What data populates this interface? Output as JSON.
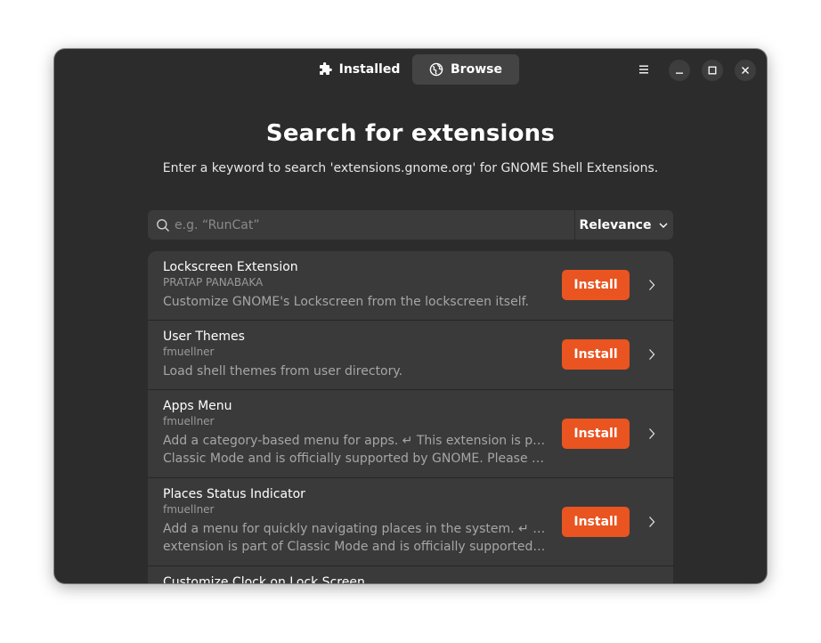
{
  "header": {
    "tabs": [
      {
        "label": "Installed",
        "icon": "puzzle-icon"
      },
      {
        "label": "Browse",
        "icon": "globe-icon"
      }
    ],
    "active_tab": "Browse",
    "buttons": [
      "menu-icon",
      "minimize-icon",
      "maximize-icon",
      "close-icon"
    ]
  },
  "main": {
    "title": "Search for extensions",
    "subtitle": "Enter a keyword to search 'extensions.gnome.org' for GNOME Shell Extensions."
  },
  "search": {
    "placeholder": "e.g. “RunCat”",
    "value": "",
    "sort_label": "Relevance"
  },
  "extensions": [
    {
      "name": "Lockscreen Extension",
      "author": "PRATAP PANABAKA",
      "description_lines": [
        "Customize GNOME's Lockscreen from the lockscreen itself."
      ],
      "button": "Install"
    },
    {
      "name": "User Themes",
      "author": "fmuellner",
      "description_lines": [
        "Load shell themes from user directory."
      ],
      "button": "Install"
    },
    {
      "name": "Apps Menu",
      "author": "fmuellner",
      "description_lines": [
        "Add a category-based menu for apps. ↵ This extension is part of",
        "Classic Mode and is officially supported by GNOME. Please do n…"
      ],
      "button": "Install"
    },
    {
      "name": "Places Status Indicator",
      "author": "fmuellner",
      "description_lines": [
        "Add a menu for quickly navigating places in the system. ↵ This",
        "extension is part of Classic Mode and is officially supported by …"
      ],
      "button": "Install"
    },
    {
      "name": "Customize Clock on Lock Screen",
      "author": "",
      "description_lines": [],
      "button": ""
    }
  ],
  "colors": {
    "accent": "#e95420",
    "window_bg": "#2c2c2c",
    "list_bg": "#3a3a3a"
  }
}
